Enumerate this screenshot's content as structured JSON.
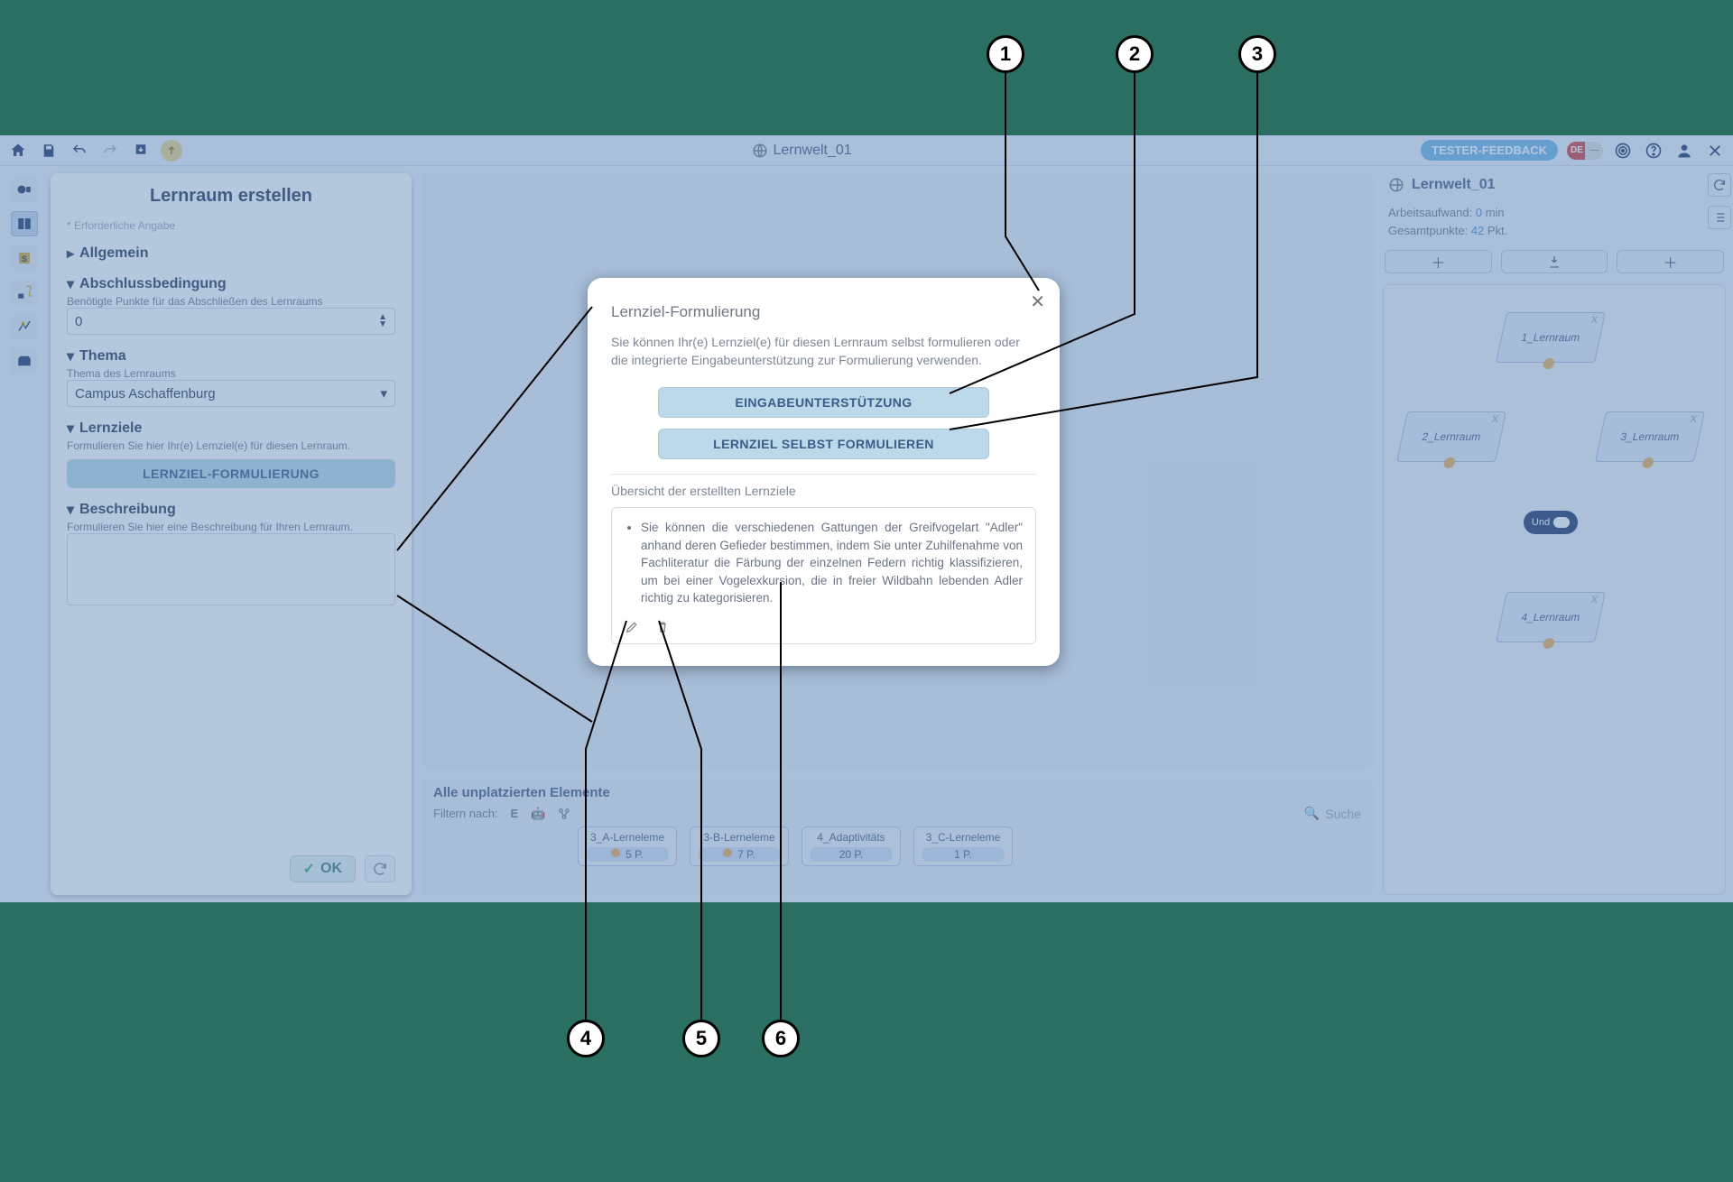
{
  "topbar": {
    "title": "Lernwelt_01",
    "tester_btn": "TESTER-FEEDBACK",
    "lang_de": "DE"
  },
  "panel": {
    "title": "Lernraum erstellen",
    "required_note": "* Erforderliche Angabe",
    "sec_general": "Allgemein",
    "sec_condition": "Abschlussbedingung",
    "sec_condition_sub": "Benötigte Punkte für das Abschließen des Lernraums",
    "points_value": "0",
    "sec_theme": "Thema",
    "sec_theme_sub": "Thema des Lernraums",
    "theme_value": "Campus Aschaffenburg",
    "sec_goals": "Lernziele",
    "sec_goals_sub": "Formulieren Sie hier Ihr(e) Lernziel(e) für diesen Lernraum.",
    "goals_btn": "LERNZIEL-FORMULIERUNG",
    "sec_desc": "Beschreibung",
    "sec_desc_sub": "Formulieren Sie hier eine Beschreibung für Ihren Lernraum.",
    "ok": "OK"
  },
  "unplaced": {
    "heading": "Alle unplatzierten Elemente",
    "filter_label": "Filtern nach:",
    "filter_E": "E",
    "search_ph": "Suche",
    "items": [
      {
        "name": "3_A-Lerneleme",
        "pts": "5 P."
      },
      {
        "name": "3-B-Lerneleme",
        "pts": "7 P."
      },
      {
        "name": "4_Adaptivitäts",
        "pts": "20 P."
      },
      {
        "name": "3_C-Lerneleme",
        "pts": "1 P."
      }
    ]
  },
  "right": {
    "title": "Lernwelt_01",
    "effort_label": "Arbeitsaufwand:",
    "effort_val": "0",
    "effort_unit": "min",
    "points_label": "Gesamtpunkte:",
    "points_val": "42",
    "points_unit": "Pkt.",
    "nodes": [
      "1_Lernraum",
      "2_Lernraum",
      "3_Lernraum",
      "4_Lernraum"
    ],
    "hub": "Und",
    "x": "X"
  },
  "modal": {
    "title": "Lernziel-Formulierung",
    "intro": "Sie können Ihr(e) Lernziel(e) für diesen Lernraum selbst formulieren oder die integrierte Eingabeunterstützung zur Formulierung verwenden.",
    "btn_assist": "EINGABEUNTERSTÜTZUNG",
    "btn_self": "LERNZIEL SELBST FORMULIEREN",
    "overview": "Übersicht der erstellten Lernziele",
    "goal_example": "Sie können die verschiedenen Gattungen der Greifvogelart \"Adler\" anhand deren Gefieder bestimmen, indem Sie unter Zuhilfenahme von Fachliteratur die Färbung der einzelnen Federn richtig klassifizieren, um bei einer Vogelexkursion, die in freier Wildbahn lebenden Adler richtig zu kategorisieren."
  },
  "callouts": {
    "1": "1",
    "2": "2",
    "3": "3",
    "4": "4",
    "5": "5",
    "6": "6"
  }
}
